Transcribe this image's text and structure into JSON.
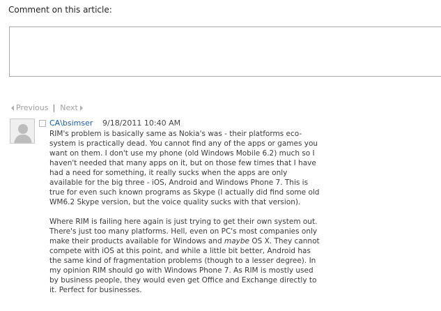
{
  "comment_form": {
    "heading": "Comment on this article:",
    "textarea_value": ""
  },
  "pager": {
    "previous_label": "Previous",
    "separator": "|",
    "next_label": "Next"
  },
  "comment": {
    "author": "CA\\bsimser",
    "timestamp": "9/18/2011 10:40 AM",
    "paragraph_1": "RIM's problem is basically same as Nokia's was - their platforms eco-system is practically dead. You cannot find any of the apps or games you want on them. I don't use my phone (old Windows Mobile 6.2) much so I haven't needed that many apps on it, but on those few times that I have had a need for something, it really sucks when the apps are only available for the big three - iOS, Android and Windows Phone 7. This is true for even such known programs as Skype (I actually did find some old WM6.2 Skype version, but the voice quality sucks with that version).",
    "paragraph_2a": "Where RIM is failing here again is just trying to get their own system out. There's just too many platforms. Hell, even on PC's most companies only make their products available for Windows and ",
    "paragraph_2_italic": "maybe",
    "paragraph_2b": " OS X. They cannot compete with iOS at this point, and while a little bit better, Android has the same kind of fragmentation problems (though to a lesser degree). In my opinion RIM should go with Windows Phone 7. As RIM is mostly used by business people, they would even get Office and Exchange directly to it. Perfect for businesses."
  },
  "icons": {
    "previous": "triangle-left-icon",
    "next": "triangle-right-icon",
    "avatar": "default-user-avatar"
  },
  "colors": {
    "link": "#1a5ea8",
    "pager_text": "#a0a0a0",
    "body_text": "#3a3a3a"
  }
}
